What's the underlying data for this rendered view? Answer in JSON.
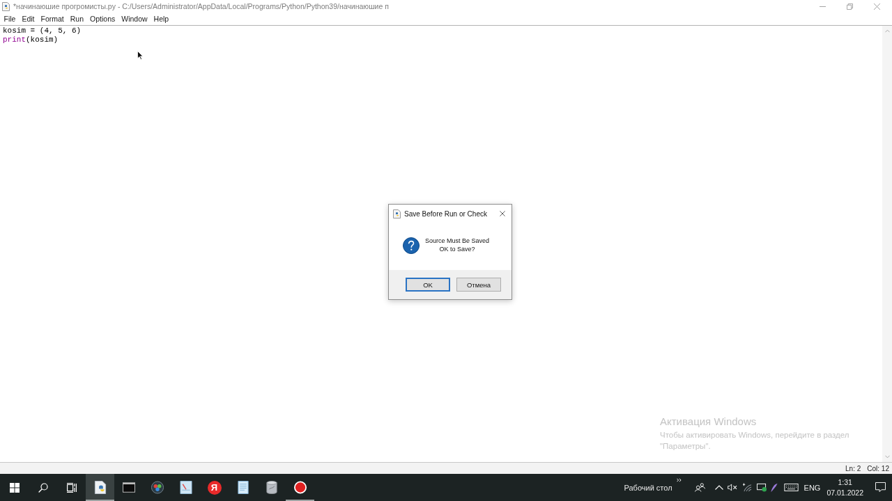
{
  "window": {
    "title": "*начинаюшие прогромисты.py - C:/Users/Administrator/AppData/Local/Programs/Python/Python39/начинаюшие п"
  },
  "menu": [
    "File",
    "Edit",
    "Format",
    "Run",
    "Options",
    "Window",
    "Help"
  ],
  "editor": {
    "lines": [
      {
        "tokens": [
          {
            "text": "kosim = (4, 5, 6)",
            "kind": "plain"
          }
        ]
      },
      {
        "tokens": [
          {
            "text": "print",
            "kind": "builtin"
          },
          {
            "text": "(kosim)",
            "kind": "plain"
          }
        ]
      }
    ]
  },
  "dialog": {
    "title": "Save Before Run or Check",
    "message": [
      "Source Must Be Saved",
      "OK to Save?"
    ],
    "buttons": [
      {
        "label": "OK",
        "focused": true
      },
      {
        "label": "Отмена",
        "focused": false
      }
    ]
  },
  "activation": {
    "title": "Активация Windows",
    "text": "Чтобы активировать Windows, перейдите в раздел \"Параметры\"."
  },
  "status_bar": {
    "line": "Ln: 2",
    "column": "Col: 12"
  },
  "taskbar": {
    "buttons": [
      {
        "kind": "start"
      },
      {
        "kind": "search"
      },
      {
        "kind": "task-view"
      }
    ],
    "apps": [
      {
        "kind": "idle",
        "selected": true,
        "running": true
      },
      {
        "kind": "terminal",
        "selected": false,
        "running": false
      },
      {
        "kind": "wheel",
        "selected": false,
        "running": false
      },
      {
        "kind": "picture",
        "selected": false,
        "running": false
      },
      {
        "kind": "browser",
        "glyph": "Я",
        "selected": false,
        "running": false
      },
      {
        "kind": "notepad",
        "selected": false,
        "running": false
      },
      {
        "kind": "disk",
        "selected": false,
        "running": false
      },
      {
        "kind": "recorder",
        "selected": false,
        "running": true
      }
    ],
    "toolbar_label": "Рабочий стол",
    "tray": [
      {
        "kind": "people"
      },
      {
        "kind": "chevron"
      },
      {
        "kind": "speaker",
        "muted": true
      },
      {
        "kind": "wifi"
      },
      {
        "kind": "network"
      },
      {
        "kind": "pen"
      },
      {
        "kind": "keyboard"
      }
    ],
    "language": "ENG",
    "time": "1:31",
    "date": "07.01.2022"
  }
}
